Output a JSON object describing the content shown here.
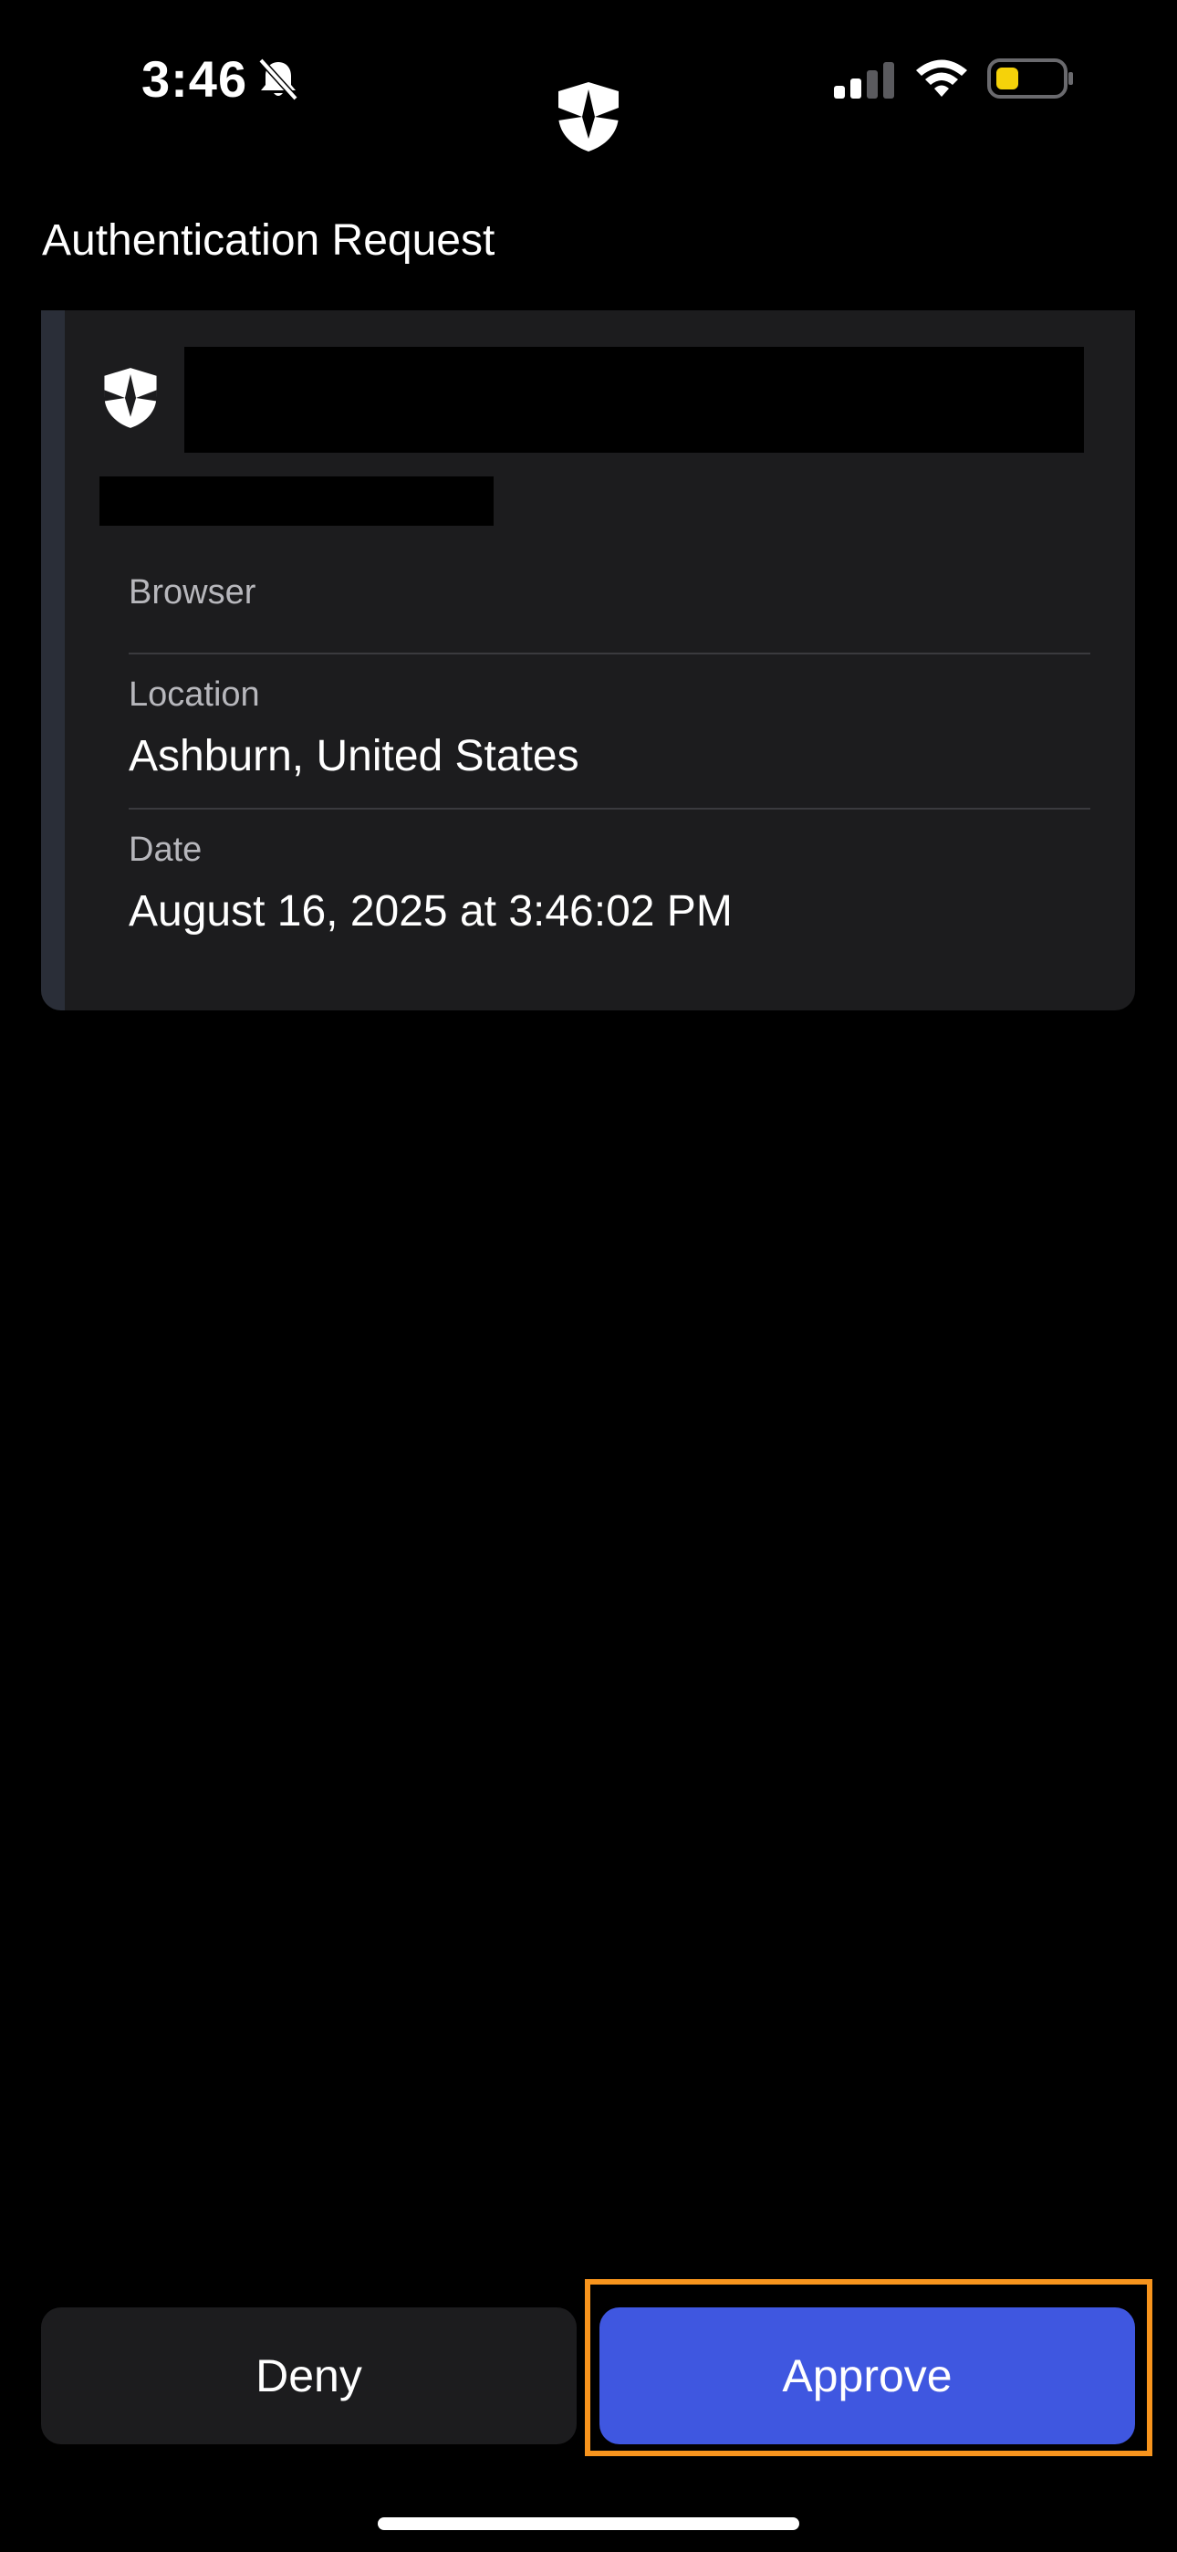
{
  "status_bar": {
    "time": "3:46",
    "icons": [
      "bell-slash-icon",
      "cellular-signal-icon",
      "wifi-icon",
      "battery-icon"
    ],
    "battery_color": "#f5d20a",
    "battery_level_fraction": 0.25
  },
  "app": {
    "logo_icon": "shield-logo-icon"
  },
  "header": {
    "title": "Authentication Request"
  },
  "request_card": {
    "icon": "shield-logo-icon",
    "details": [
      {
        "label": "Browser",
        "value": ""
      },
      {
        "label": "Location",
        "value": "Ashburn, United States"
      },
      {
        "label": "Date",
        "value": "August 16, 2025 at 3:46:02 PM"
      }
    ]
  },
  "actions": {
    "deny_label": "Deny",
    "approve_label": "Approve",
    "approve_color": "#3f57e0",
    "highlight_color": "#f7941d"
  }
}
